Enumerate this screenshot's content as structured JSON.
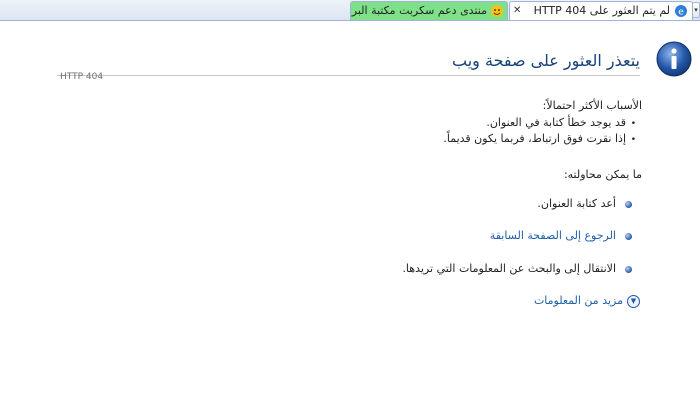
{
  "tabs": [
    {
      "title": "لم يتم العثور على HTTP 404",
      "active": true,
      "icon": "ie-page-icon"
    },
    {
      "title": "منتدى دعم سكربت مكتبة البرام...",
      "active": false,
      "icon": "forum-favicon"
    }
  ],
  "page": {
    "title": "يتعذر العثور على صفحة ويب",
    "code": "HTTP 404",
    "icon": "info-icon"
  },
  "causes": {
    "heading": "الأسباب الأكثر احتمالاً:",
    "items": [
      "قد يوجد خطأ كتابة في العنوان.",
      "إذا نقرت فوق ارتباط، فربما يكون قديماً."
    ]
  },
  "try": {
    "heading": "ما يمكن محاولته:",
    "actions": [
      {
        "label": "أعد كتابة العنوان.",
        "link": false
      },
      {
        "label": "الرجوع إلى الصفحة السابقة",
        "link": true
      },
      {
        "label": "الانتقال إلى  والبحث عن المعلومات التي تريدها.",
        "link": false
      }
    ]
  },
  "more_info": {
    "label": "مزيد من المعلومات",
    "icon": "chevron-down-circle-icon"
  },
  "colors": {
    "title": "#17417a",
    "link": "#1f5fa8",
    "inactive_tab": "#7fe08a"
  }
}
